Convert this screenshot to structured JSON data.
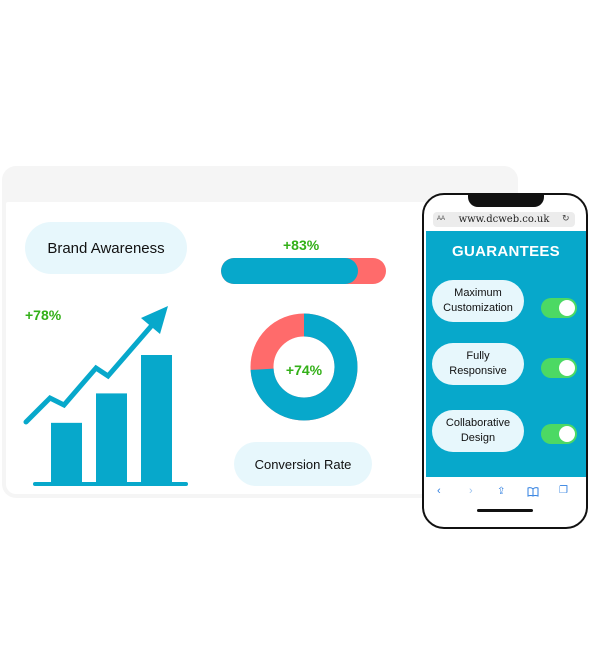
{
  "dashboard": {
    "brand_label": "Brand Awareness",
    "growth_pct": "+78%",
    "progress_pct": "+83%",
    "progress_value": 0.83,
    "donut_pct": "+74%",
    "donut_value": 0.74,
    "conversion_label": "Conversion Rate",
    "bars": [
      0.47,
      0.7,
      1.0
    ],
    "colors": {
      "teal": "#07a8cb",
      "coral": "#ff6b6b",
      "green": "#33b018",
      "pill": "#e7f7fc"
    }
  },
  "phone": {
    "url": "www.dcweb.co.uk",
    "text_size_label": "AA",
    "heading": "GUARANTEES",
    "options": [
      {
        "line1": "Maximum",
        "line2": "Customization",
        "enabled": true
      },
      {
        "line1": "Fully",
        "line2": "Responsive",
        "enabled": true
      },
      {
        "line1": "Collaborative",
        "line2": "Design",
        "enabled": true
      }
    ],
    "nav_icons": [
      "back-icon",
      "forward-icon",
      "share-icon",
      "bookmarks-icon",
      "tabs-icon"
    ],
    "nav_glyphs": {
      "back": "‹",
      "forward": "›",
      "share": "⇪",
      "bookmarks": "📖",
      "tabs": "❐",
      "reload": "↻"
    }
  }
}
